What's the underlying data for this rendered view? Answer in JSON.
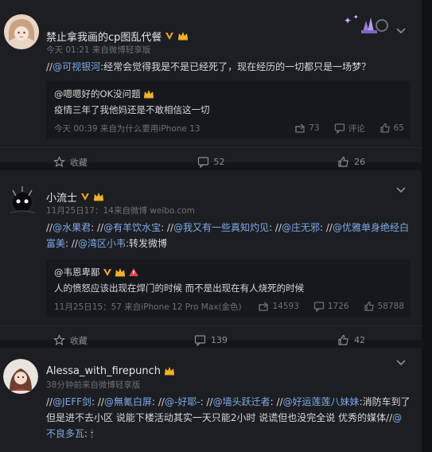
{
  "posts": [
    {
      "username": "禁止拿我画的cp图乱代餐",
      "meta": "今天 01:21 来自微博轻享版",
      "text_parts": [
        {
          "t": "//",
          "c": "slash"
        },
        {
          "t": "@可视银河",
          "c": "at"
        },
        {
          "t": ":经常会觉得我是不是已经死了，现在经历的一切都只是一场梦？",
          "c": "plain"
        }
      ],
      "repost": {
        "user": "@嗯嗯好的OK没问题",
        "text": "疫情三年了我他妈还是不敢相信这一切",
        "time": "今天 00:39 来自为什么要用iPhone 13",
        "reposts": "73",
        "comments": "评论",
        "likes": "65"
      },
      "actions": {
        "fav": "收藏",
        "comments": "52",
        "likes": "26"
      }
    },
    {
      "username": "小流士",
      "meta": "11月25日17：14来自微博 weibo.com",
      "text_parts": [
        {
          "t": "//",
          "c": "slash"
        },
        {
          "t": "@水果君",
          "c": "at"
        },
        {
          "t": ": //",
          "c": "slash"
        },
        {
          "t": "@有羊饮水宝",
          "c": "at"
        },
        {
          "t": ": //",
          "c": "slash"
        },
        {
          "t": "@我又有一些真知灼见",
          "c": "at"
        },
        {
          "t": ": //",
          "c": "slash"
        },
        {
          "t": "@庄无邪",
          "c": "at"
        },
        {
          "t": ": //",
          "c": "slash"
        },
        {
          "t": "@优雅单身绝经白富美",
          "c": "at"
        },
        {
          "t": ": //",
          "c": "slash"
        },
        {
          "t": "@湾区小韦",
          "c": "at"
        },
        {
          "t": ":转发微博",
          "c": "plain"
        }
      ],
      "repost": {
        "user": "@韦恩卑鄙",
        "text": "人的愤怒应该出现在焊门的时候 而不是出现在有人烧死的时候",
        "time": "11月25日15：57 来自iPhone 12 Pro Max(金色)",
        "reposts": "14593",
        "comments": "1726",
        "likes": "58788"
      },
      "actions": {
        "fav": "收藏",
        "comments": "139",
        "likes": "42"
      }
    },
    {
      "username": "Alessa_with_firepunch",
      "meta": "38分钟前来自微博轻享版",
      "text_parts": [
        {
          "t": "//",
          "c": "slash"
        },
        {
          "t": "@JEFF剑",
          "c": "at"
        },
        {
          "t": ": //",
          "c": "slash"
        },
        {
          "t": "@無氰白屏",
          "c": "at"
        },
        {
          "t": ": //",
          "c": "slash"
        },
        {
          "t": "@-好耶-",
          "c": "at"
        },
        {
          "t": ": //",
          "c": "slash"
        },
        {
          "t": "@墙头跃迁者",
          "c": "at"
        },
        {
          "t": ": //",
          "c": "slash"
        },
        {
          "t": "@好运莲莲八妹妹",
          "c": "at"
        },
        {
          "t": ":消防车到了但是进不去小区 说能下楼活动其实一天只能2小时 说谎但也没完全说 优秀的媒体//",
          "c": "plain"
        },
        {
          "t": "@不良多瓦",
          "c": "at"
        },
        {
          "t": ": 🕯",
          "c": "plain"
        }
      ]
    }
  ],
  "colors": {
    "bg": "#141518",
    "card": "#1d1e22",
    "mention": "#7ea9e8",
    "vip": "#f5a623"
  }
}
